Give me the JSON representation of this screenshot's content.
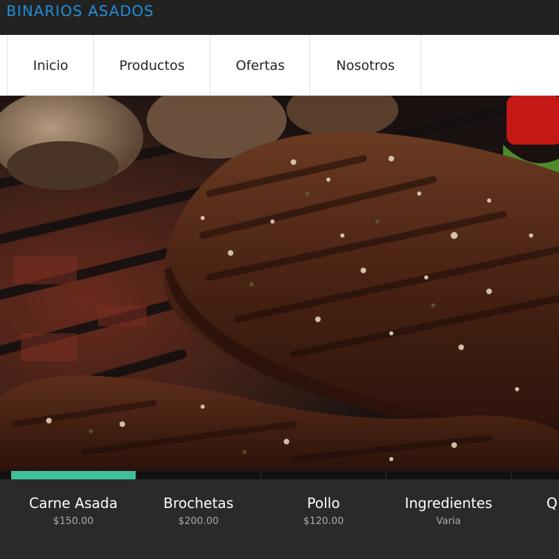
{
  "header": {
    "brand": "BINARIOS ASADOS"
  },
  "nav": {
    "items": [
      {
        "label": "Inicio"
      },
      {
        "label": "Productos"
      },
      {
        "label": "Ofertas"
      },
      {
        "label": "Nosotros"
      }
    ]
  },
  "hero": {
    "image": "grilled steak on grill with mushrooms"
  },
  "products": {
    "active_index": 0,
    "items": [
      {
        "name": "Carne Asada",
        "price": "$150.00"
      },
      {
        "name": "Brochetas",
        "price": "$200.00"
      },
      {
        "name": "Pollo",
        "price": "$120.00"
      },
      {
        "name": "Ingredientes",
        "price": "Varia"
      },
      {
        "name": "Q",
        "price": ""
      }
    ]
  },
  "colors": {
    "brand": "#1e8fd8",
    "accent": "#3fbf9a",
    "topbar": "#222222",
    "product_bar": "#2a2a2a"
  }
}
